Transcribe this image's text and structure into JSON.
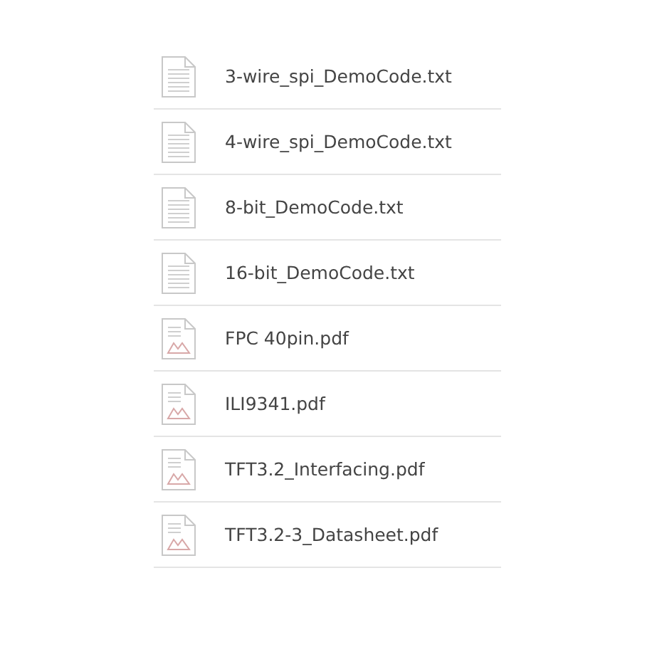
{
  "files": [
    {
      "name": "3-wire_spi_DemoCode.txt",
      "kind": "text"
    },
    {
      "name": "4-wire_spi_DemoCode.txt",
      "kind": "text"
    },
    {
      "name": "8-bit_DemoCode.txt",
      "kind": "text"
    },
    {
      "name": "16-bit_DemoCode.txt",
      "kind": "text"
    },
    {
      "name": "FPC 40pin.pdf",
      "kind": "pdf"
    },
    {
      "name": "ILI9341.pdf",
      "kind": "pdf"
    },
    {
      "name": "TFT3.2_Interfacing.pdf",
      "kind": "pdf"
    },
    {
      "name": "TFT3.2-3_Datasheet.pdf",
      "kind": "pdf"
    }
  ]
}
